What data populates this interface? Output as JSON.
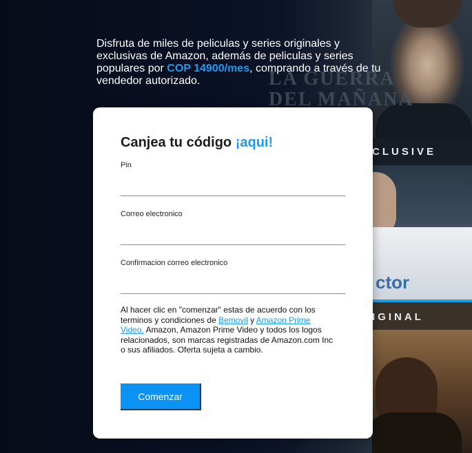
{
  "intro": {
    "text_before": "Disfruta de miles de peliculas y series originales y exclusivas de Amazon, además de peliculas y series populares por ",
    "price": "COP 14900/mes",
    "text_after": ", comprando a través de tu vendedor autorizado."
  },
  "posters": {
    "title_line1": "LA GUERRA",
    "title_line2": "DEL MAÑANA",
    "exclusive_label": "CLUSIVE",
    "original_label": "IGINAL",
    "partial_word": "ctor"
  },
  "form": {
    "title": "Canjea tu código",
    "title_accent": "¡aqui!",
    "pin_label": "Pin",
    "email_label": "Correo electronico",
    "email_confirm_label": "Confirmacion correo electronico",
    "terms_before": "Al hacer clic en \"comenzar\" estas de acuerdo con los terminos y condiciones de ",
    "terms_link1": "Bemovil",
    "terms_mid": " y ",
    "terms_link2": "Amazon Prime Video.",
    "terms_after": " Amazon, Amazon Prime Video y todos los logos relacionados, son marcas registradas de Amazon.com Inc o sus afiliados. Oferta sujeta a cambio.",
    "submit_label": "Comenzar"
  },
  "colors": {
    "accent": "#1a9bf0",
    "button": "#0a93f5",
    "background": "#0b0f1f"
  }
}
